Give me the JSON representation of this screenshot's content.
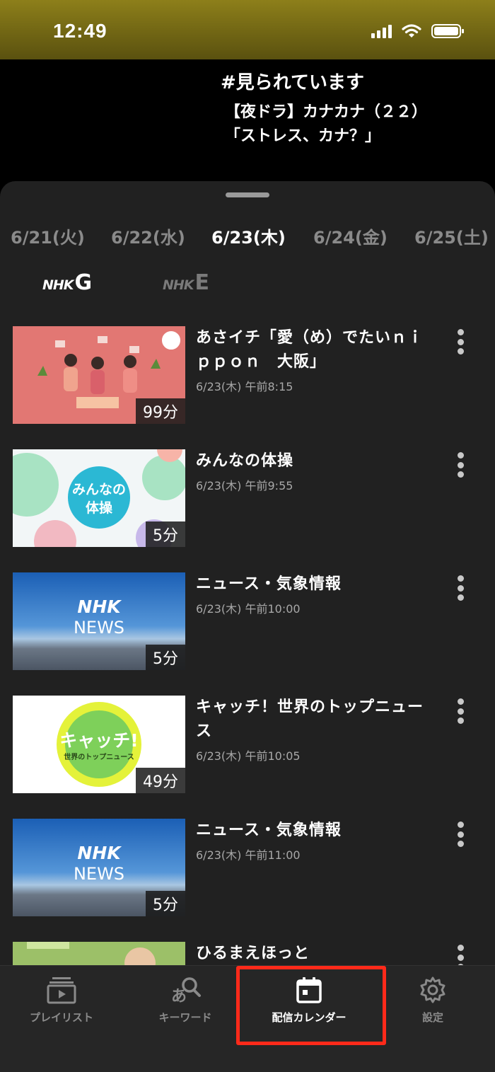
{
  "status": {
    "time": "12:49"
  },
  "now_playing": {
    "heading": "#見られています",
    "line1": "【夜ドラ】カナカナ（２２）",
    "line2": "「ストレス、カナ？」"
  },
  "dates": [
    "6/21(火)",
    "6/22(水)",
    "6/23(木)",
    "6/24(金)",
    "6/25(土)"
  ],
  "active_date": "6/23(木)",
  "channels": [
    {
      "mark": "NHK",
      "letter": "G",
      "active": true
    },
    {
      "mark": "NHK",
      "letter": "E",
      "active": false
    }
  ],
  "programs": [
    {
      "title": "あさイチ「愛（め）でたいｎｉｐｐｏｎ　大阪」",
      "datetime": "6/23(木) 午前8:15",
      "duration": "99分"
    },
    {
      "title": "みんなの体操",
      "datetime": "6/23(木) 午前9:55",
      "duration": "5分",
      "thumb_text": "みんなの体操"
    },
    {
      "title": "ニュース・気象情報",
      "datetime": "6/23(木) 午前10:00",
      "duration": "5分",
      "thumb_text_1": "NHK",
      "thumb_text_2": "NEWS"
    },
    {
      "title": "キャッチ！世界のトップニュース",
      "datetime": "6/23(木) 午前10:05",
      "duration": "49分",
      "thumb_text_1": "キャッチ!",
      "thumb_text_2": "世界のトップニュース"
    },
    {
      "title": "ニュース・気象情報",
      "datetime": "6/23(木) 午前11:00",
      "duration": "5分",
      "thumb_text_1": "NHK",
      "thumb_text_2": "NEWS"
    },
    {
      "title": "ひるまえほっと"
    }
  ],
  "nav": {
    "playlist": "プレイリスト",
    "keyword": "キーワード",
    "calendar": "配信カレンダー",
    "settings": "設定"
  },
  "colors": {
    "accent_highlight": "#ff2a1a",
    "sheet_bg": "#212121",
    "status_bar": "#8d7f1a"
  }
}
